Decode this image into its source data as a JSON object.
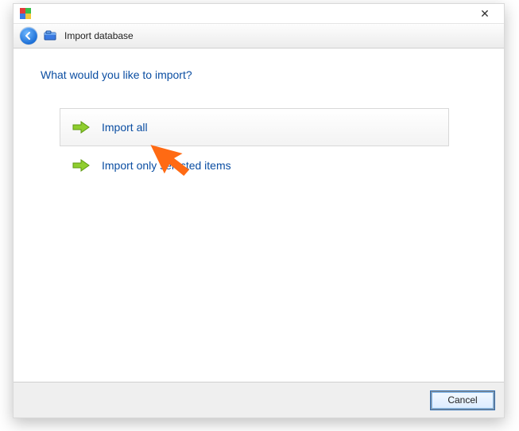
{
  "window": {
    "title": "Import database"
  },
  "heading": "What would you like to import?",
  "options": [
    {
      "label": "Import all"
    },
    {
      "label": "Import only selected items"
    }
  ],
  "footer": {
    "cancel": "Cancel"
  }
}
